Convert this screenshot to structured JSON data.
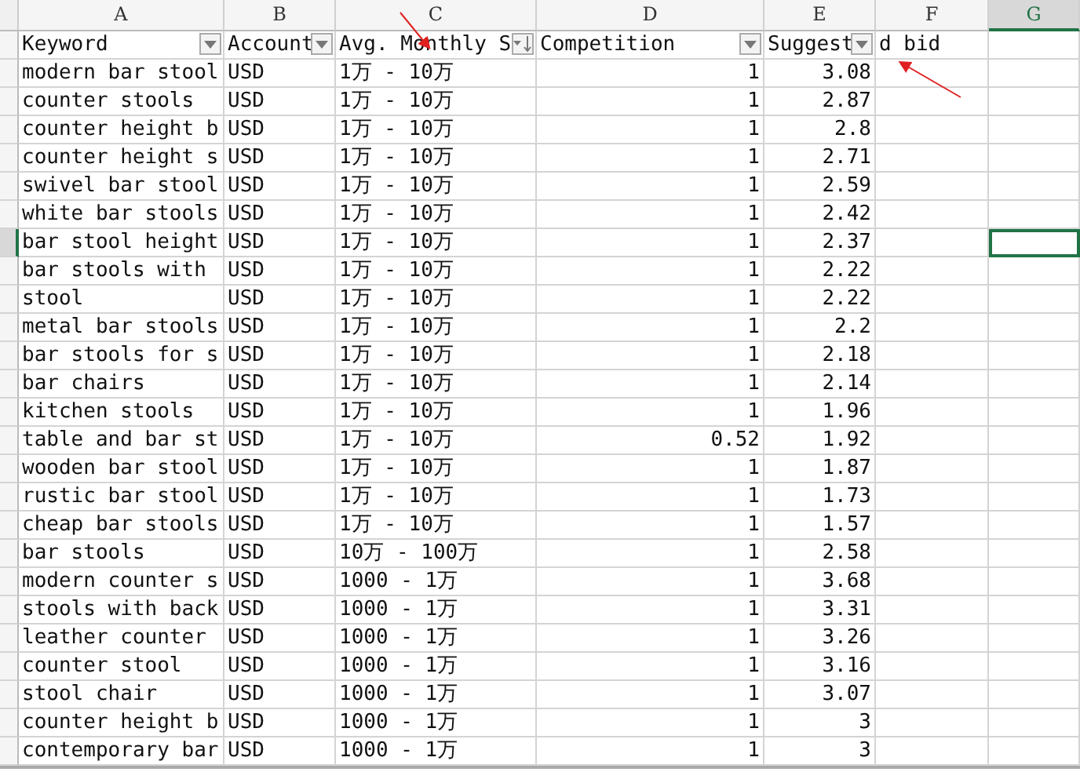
{
  "columns": [
    {
      "letter": "A",
      "selected": false
    },
    {
      "letter": "B",
      "selected": false
    },
    {
      "letter": "C",
      "selected": false
    },
    {
      "letter": "D",
      "selected": false
    },
    {
      "letter": "E",
      "selected": false
    },
    {
      "letter": "F",
      "selected": false
    },
    {
      "letter": "G",
      "selected": true
    }
  ],
  "header_row": {
    "keyword": "Keyword",
    "account": "Account",
    "searches": "Avg. Monthly S",
    "competition": "Competition",
    "bid": "Suggest",
    "bid_overflow": "d bid"
  },
  "rows": [
    {
      "keyword": "modern bar stool",
      "currency": "USD",
      "searches": "1万 - 10万",
      "competition": "1",
      "bid": "3.08",
      "selected": false
    },
    {
      "keyword": "counter stools",
      "currency": "USD",
      "searches": "1万 - 10万",
      "competition": "1",
      "bid": "2.87",
      "selected": false
    },
    {
      "keyword": "counter height b",
      "currency": "USD",
      "searches": "1万 - 10万",
      "competition": "1",
      "bid": "2.8",
      "selected": false
    },
    {
      "keyword": "counter height s",
      "currency": "USD",
      "searches": "1万 - 10万",
      "competition": "1",
      "bid": "2.71",
      "selected": false
    },
    {
      "keyword": "swivel bar stool",
      "currency": "USD",
      "searches": "1万 - 10万",
      "competition": "1",
      "bid": "2.59",
      "selected": false
    },
    {
      "keyword": "white bar stools",
      "currency": "USD",
      "searches": "1万 - 10万",
      "competition": "1",
      "bid": "2.42",
      "selected": false
    },
    {
      "keyword": "bar stool height",
      "currency": "USD",
      "searches": "1万 - 10万",
      "competition": "1",
      "bid": "2.37",
      "selected": true
    },
    {
      "keyword": "bar stools with",
      "currency": "USD",
      "searches": "1万 - 10万",
      "competition": "1",
      "bid": "2.22",
      "selected": false
    },
    {
      "keyword": "stool",
      "currency": "USD",
      "searches": "1万 - 10万",
      "competition": "1",
      "bid": "2.22",
      "selected": false
    },
    {
      "keyword": "metal bar stools",
      "currency": "USD",
      "searches": "1万 - 10万",
      "competition": "1",
      "bid": "2.2",
      "selected": false
    },
    {
      "keyword": "bar stools for s",
      "currency": "USD",
      "searches": "1万 - 10万",
      "competition": "1",
      "bid": "2.18",
      "selected": false
    },
    {
      "keyword": "bar chairs",
      "currency": "USD",
      "searches": "1万 - 10万",
      "competition": "1",
      "bid": "2.14",
      "selected": false
    },
    {
      "keyword": "kitchen stools",
      "currency": "USD",
      "searches": "1万 - 10万",
      "competition": "1",
      "bid": "1.96",
      "selected": false
    },
    {
      "keyword": "table and bar st",
      "currency": "USD",
      "searches": "1万 - 10万",
      "competition": "0.52",
      "bid": "1.92",
      "selected": false
    },
    {
      "keyword": "wooden bar stool",
      "currency": "USD",
      "searches": "1万 - 10万",
      "competition": "1",
      "bid": "1.87",
      "selected": false
    },
    {
      "keyword": "rustic bar stool",
      "currency": "USD",
      "searches": "1万 - 10万",
      "competition": "1",
      "bid": "1.73",
      "selected": false
    },
    {
      "keyword": "cheap bar stools",
      "currency": "USD",
      "searches": "1万 - 10万",
      "competition": "1",
      "bid": "1.57",
      "selected": false
    },
    {
      "keyword": "bar stools",
      "currency": "USD",
      "searches": "10万 - 100万",
      "competition": "1",
      "bid": "2.58",
      "selected": false
    },
    {
      "keyword": "modern counter s",
      "currency": "USD",
      "searches": "1000 - 1万",
      "competition": "1",
      "bid": "3.68",
      "selected": false
    },
    {
      "keyword": "stools with back",
      "currency": "USD",
      "searches": "1000 - 1万",
      "competition": "1",
      "bid": "3.31",
      "selected": false
    },
    {
      "keyword": "leather counter",
      "currency": "USD",
      "searches": "1000 - 1万",
      "competition": "1",
      "bid": "3.26",
      "selected": false
    },
    {
      "keyword": "counter stool",
      "currency": "USD",
      "searches": "1000 - 1万",
      "competition": "1",
      "bid": "3.16",
      "selected": false
    },
    {
      "keyword": "stool chair",
      "currency": "USD",
      "searches": "1000 - 1万",
      "competition": "1",
      "bid": "3.07",
      "selected": false
    },
    {
      "keyword": "counter height b",
      "currency": "USD",
      "searches": "1000 - 1万",
      "competition": "1",
      "bid": "3",
      "selected": false
    },
    {
      "keyword": "contemporary bar",
      "currency": "USD",
      "searches": "1000 - 1万",
      "competition": "1",
      "bid": "3",
      "selected": false
    }
  ]
}
